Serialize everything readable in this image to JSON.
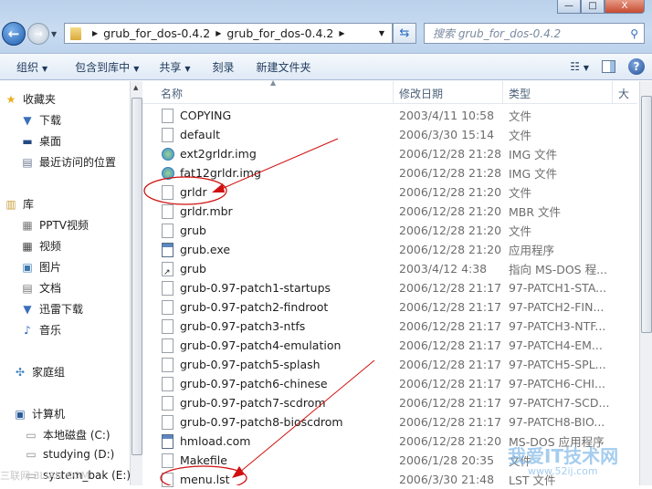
{
  "window": {
    "minimize": "—",
    "maximize": "□",
    "close": "X"
  },
  "address": {
    "segments": [
      "grub_for_dos-0.4.2",
      "grub_for_dos-0.4.2"
    ]
  },
  "search": {
    "placeholder": "搜索 grub_for_dos-0.4.2"
  },
  "toolbar": {
    "organize": "组织",
    "include_library": "包含到库中",
    "share": "共享",
    "burn": "刻录",
    "new_folder": "新建文件夹"
  },
  "sidebar": {
    "favorites": "收藏夹",
    "downloads": "下载",
    "desktop": "桌面",
    "recent": "最近访问的位置",
    "libraries": "库",
    "pptv": "PPTV视频",
    "videos": "视频",
    "pictures": "图片",
    "documents": "文档",
    "thunder": "迅雷下载",
    "music": "音乐",
    "homegroup": "家庭组",
    "computer": "计算机",
    "drive_c": "本地磁盘 (C:)",
    "drive_d": "studying (D:)",
    "drive_e": "system_bak (E:)"
  },
  "columns": {
    "name": "名称",
    "date": "修改日期",
    "type": "类型",
    "size": "大"
  },
  "files": [
    {
      "name": "COPYING",
      "date": "2003/4/11 10:58",
      "type": "文件",
      "icon": "file"
    },
    {
      "name": "default",
      "date": "2006/3/30 15:14",
      "type": "文件",
      "icon": "file"
    },
    {
      "name": "ext2grldr.img",
      "date": "2006/12/28 21:28",
      "type": "IMG 文件",
      "icon": "img"
    },
    {
      "name": "fat12grldr.img",
      "date": "2006/12/28 21:28",
      "type": "IMG 文件",
      "icon": "img"
    },
    {
      "name": "grldr",
      "date": "2006/12/28 21:20",
      "type": "文件",
      "icon": "file"
    },
    {
      "name": "grldr.mbr",
      "date": "2006/12/28 21:20",
      "type": "MBR 文件",
      "icon": "file"
    },
    {
      "name": "grub",
      "date": "2006/12/28 21:20",
      "type": "文件",
      "icon": "file"
    },
    {
      "name": "grub.exe",
      "date": "2006/12/28 21:20",
      "type": "应用程序",
      "icon": "exe"
    },
    {
      "name": "grub",
      "date": "2003/4/12 4:38",
      "type": "指向 MS-DOS 程...",
      "icon": "lnk"
    },
    {
      "name": "grub-0.97-patch1-startups",
      "date": "2006/12/28 21:17",
      "type": "97-PATCH1-STA...",
      "icon": "file"
    },
    {
      "name": "grub-0.97-patch2-findroot",
      "date": "2006/12/28 21:17",
      "type": "97-PATCH2-FIN...",
      "icon": "file"
    },
    {
      "name": "grub-0.97-patch3-ntfs",
      "date": "2006/12/28 21:17",
      "type": "97-PATCH3-NTF...",
      "icon": "file"
    },
    {
      "name": "grub-0.97-patch4-emulation",
      "date": "2006/12/28 21:17",
      "type": "97-PATCH4-EM...",
      "icon": "file"
    },
    {
      "name": "grub-0.97-patch5-splash",
      "date": "2006/12/28 21:17",
      "type": "97-PATCH5-SPL...",
      "icon": "file"
    },
    {
      "name": "grub-0.97-patch6-chinese",
      "date": "2006/12/28 21:17",
      "type": "97-PATCH6-CHI...",
      "icon": "file"
    },
    {
      "name": "grub-0.97-patch7-scdrom",
      "date": "2006/12/28 21:17",
      "type": "97-PATCH7-SCD...",
      "icon": "file"
    },
    {
      "name": "grub-0.97-patch8-bioscdrom",
      "date": "2006/12/28 21:17",
      "type": "97-PATCH8-BIO...",
      "icon": "file"
    },
    {
      "name": "hmload.com",
      "date": "2006/12/28 21:20",
      "type": "MS-DOS 应用程序",
      "icon": "exe"
    },
    {
      "name": "Makefile",
      "date": "2006/1/28 20:35",
      "type": "文件",
      "icon": "file"
    },
    {
      "name": "menu.lst",
      "date": "2006/3/30 21:48",
      "type": "LST 文件",
      "icon": "file"
    }
  ],
  "watermarks": {
    "site1": "我爱IT技术网",
    "site1_url": "www.52ij.com",
    "site2": "三联网 3LIAN.COM"
  },
  "colors": {
    "annotation": "#d01010",
    "accent": "#2a6bbf"
  }
}
